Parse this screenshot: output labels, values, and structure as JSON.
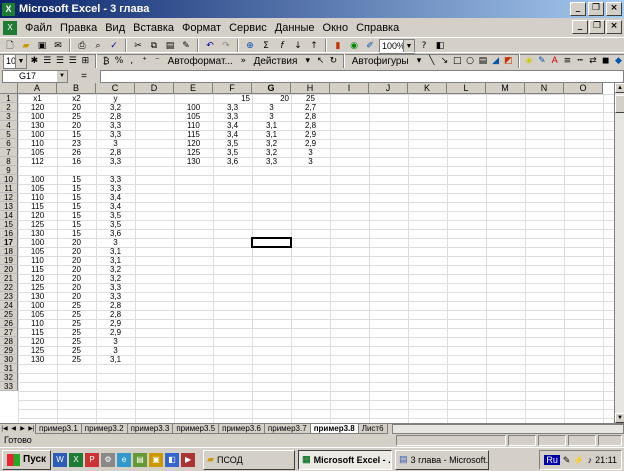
{
  "window": {
    "title": "Microsoft Excel - 3 глава",
    "app_icon": "excel-icon"
  },
  "menu": [
    "Файл",
    "Правка",
    "Вид",
    "Вставка",
    "Формат",
    "Сервис",
    "Данные",
    "Окно",
    "Справка"
  ],
  "toolbar1": {
    "zoom": "100%"
  },
  "toolbar2": {
    "font_size": "10",
    "autoformat_label": "Автоформат...",
    "actions_label": "Действия",
    "autoshapes_label": "Автофигуры"
  },
  "formula_bar": {
    "name_box": "G17",
    "formula": ""
  },
  "columns": [
    "A",
    "B",
    "C",
    "D",
    "E",
    "F",
    "G",
    "H",
    "I",
    "J",
    "K",
    "L",
    "M",
    "N",
    "O"
  ],
  "rows": [
    [
      "x1",
      "x2",
      "y",
      "",
      "",
      "",
      "15",
      "20",
      "25"
    ],
    [
      "120",
      "20",
      "3,2",
      "",
      "100",
      "3,3",
      "3",
      "2,7"
    ],
    [
      "100",
      "25",
      "2,8",
      "",
      "105",
      "3,3",
      "3",
      "2,8"
    ],
    [
      "130",
      "20",
      "3,3",
      "",
      "110",
      "3,4",
      "3,1",
      "2,8"
    ],
    [
      "100",
      "15",
      "3,3",
      "",
      "115",
      "3,4",
      "3,1",
      "2,9"
    ],
    [
      "110",
      "23",
      "3",
      "",
      "120",
      "3,5",
      "3,2",
      "2,9"
    ],
    [
      "105",
      "26",
      "2,8",
      "",
      "125",
      "3,5",
      "3,2",
      "3"
    ],
    [
      "112",
      "16",
      "3,3",
      "",
      "130",
      "3,6",
      "3,3",
      "3"
    ],
    [],
    [
      "100",
      "15",
      "3,3"
    ],
    [
      "105",
      "15",
      "3,3"
    ],
    [
      "110",
      "15",
      "3,4"
    ],
    [
      "115",
      "15",
      "3,4"
    ],
    [
      "120",
      "15",
      "3,5"
    ],
    [
      "125",
      "15",
      "3,5"
    ],
    [
      "130",
      "15",
      "3,6"
    ],
    [
      "100",
      "20",
      "3"
    ],
    [
      "105",
      "20",
      "3,1"
    ],
    [
      "110",
      "20",
      "3,1"
    ],
    [
      "115",
      "20",
      "3,2"
    ],
    [
      "120",
      "20",
      "3,2"
    ],
    [
      "125",
      "20",
      "3,3"
    ],
    [
      "130",
      "20",
      "3,3"
    ],
    [
      "100",
      "25",
      "2,8"
    ],
    [
      "105",
      "25",
      "2,8"
    ],
    [
      "110",
      "25",
      "2,9"
    ],
    [
      "115",
      "25",
      "2,9"
    ],
    [
      "120",
      "25",
      "3"
    ],
    [
      "125",
      "25",
      "3"
    ],
    [
      "130",
      "25",
      "3,1"
    ],
    [],
    [],
    []
  ],
  "sheet_tabs": [
    "пример3.1",
    "пример3.2",
    "пример3.3",
    "пример3.5",
    "пример3.6",
    "пример3.7",
    "пример3.8",
    "Лист6"
  ],
  "active_sheet": "пример3.8",
  "status": "Готово",
  "taskbar": {
    "start": "Пуск",
    "tasks": [
      "ПСОД",
      "Microsoft Excel - ...",
      "3 глава - Microsoft..."
    ],
    "tray_lang": "Ru",
    "clock": "21:11"
  }
}
